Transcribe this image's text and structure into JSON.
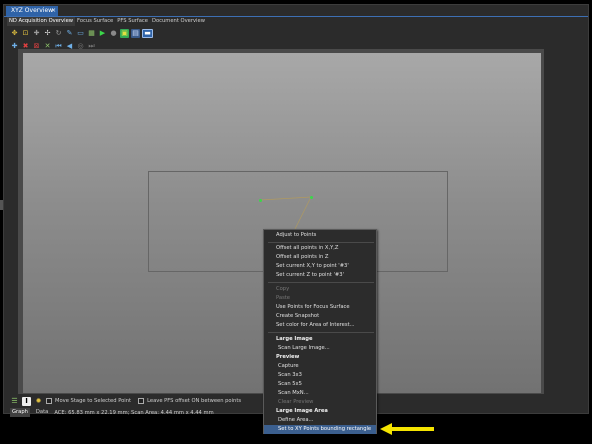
{
  "window": {
    "title": "XYZ Overview",
    "close": "×"
  },
  "tabs": [
    {
      "label": "ND Acquisition Overview",
      "active": true
    },
    {
      "label": "Focus Surface",
      "active": false
    },
    {
      "label": "PFS Surface",
      "active": false
    },
    {
      "label": "Document Overview",
      "active": false
    }
  ],
  "toolbar1_icons": [
    "cursor-tool-icon",
    "select-rect-icon",
    "add-point-icon",
    "move-point-icon",
    "rotate-icon",
    "draw-icon",
    "ruler-icon",
    "grid-icon",
    "capture-icon",
    "record-icon",
    "snapshot-icon",
    "layout-icon",
    "display-mode-icon"
  ],
  "toolbar2_icons": [
    "add-icon",
    "delete-icon",
    "delete-all-icon",
    "split-icon",
    "first-icon",
    "previous-icon",
    "target-icon",
    "last-icon"
  ],
  "bottom": {
    "move_stage_label": "Move Stage to Selected Point",
    "leave_pfs_label": "Leave PFS offset ON between points"
  },
  "status": {
    "tabs": [
      "Graph",
      "Data"
    ],
    "text": "ACE: 65.83 mm x 22.19 mm; Scan Area: 4.44 mm x 4.44 mm"
  },
  "context_menu": {
    "items": [
      {
        "label": "Adjust to Points",
        "kind": "item"
      },
      {
        "label": "Offset all points in X,Y,Z",
        "kind": "item"
      },
      {
        "label": "Offset all points in Z",
        "kind": "item"
      },
      {
        "label": "Set current X,Y to point '#3'",
        "kind": "item"
      },
      {
        "label": "Set current Z to point '#3'",
        "kind": "item"
      },
      {
        "label": "Copy",
        "kind": "disabled"
      },
      {
        "label": "Paste",
        "kind": "disabled"
      },
      {
        "label": "Use Points for Focus Surface",
        "kind": "item"
      },
      {
        "label": "Create Snapshot",
        "kind": "item"
      },
      {
        "label": "Set color for Area of Interest...",
        "kind": "item"
      },
      {
        "label": "Large Image",
        "kind": "header"
      },
      {
        "label": "Scan Large Image...",
        "kind": "sub"
      },
      {
        "label": "Preview",
        "kind": "header"
      },
      {
        "label": "Capture",
        "kind": "sub"
      },
      {
        "label": "Scan 3x3",
        "kind": "sub"
      },
      {
        "label": "Scan 5x5",
        "kind": "sub"
      },
      {
        "label": "Scan MxN...",
        "kind": "sub"
      },
      {
        "label": "Clear Preview",
        "kind": "sub-disabled"
      },
      {
        "label": "Large Image Area",
        "kind": "header"
      },
      {
        "label": "Define Area...",
        "kind": "sub"
      },
      {
        "label": "Set to XY Points bounding rectangle",
        "kind": "selected"
      }
    ]
  },
  "colors": {
    "accent": "#2f63a8",
    "selected": "#3b5f8f",
    "point": "#3bd64a",
    "arrow": "#f5e400"
  }
}
